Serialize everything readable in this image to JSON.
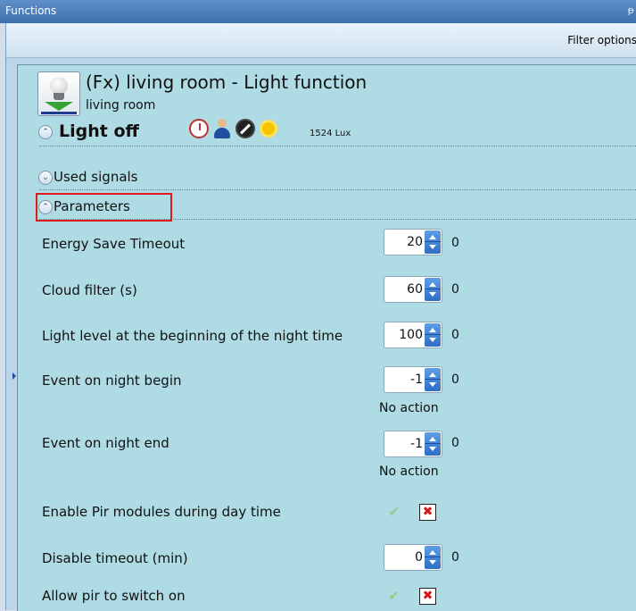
{
  "window": {
    "title": "Functions"
  },
  "toolbar": {
    "filter_label": "Filter options"
  },
  "function": {
    "title": "(Fx) living room - Light function",
    "room": "living room",
    "state": "Light off",
    "lux": "1524 Lux"
  },
  "sections": {
    "used_signals": "Used signals",
    "parameters": "Parameters"
  },
  "params": [
    {
      "label": "Energy Save Timeout",
      "value": "20",
      "extra": "0"
    },
    {
      "label": "Cloud filter (s)",
      "value": "60",
      "extra": "0"
    },
    {
      "label": "Light level at the beginning of the night time",
      "value": "100",
      "extra": "0"
    },
    {
      "label": "Event on night begin",
      "value": "-1",
      "extra": "0",
      "note": "No action"
    },
    {
      "label": "Event on night end",
      "value": "-1",
      "extra": "0",
      "note": "No action"
    },
    {
      "label": "Enable Pir modules during day time"
    },
    {
      "label": "Disable timeout (min)",
      "value": "0",
      "extra": "0"
    },
    {
      "label": "Allow pir to switch on"
    }
  ]
}
